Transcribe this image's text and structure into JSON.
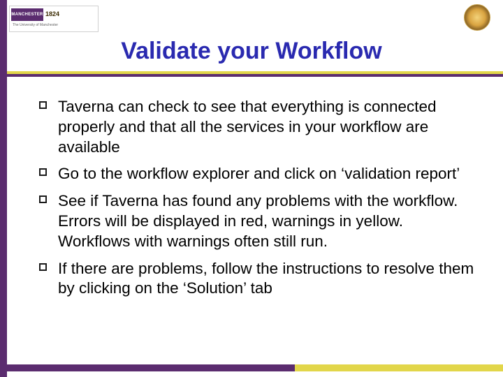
{
  "logo": {
    "badge": "MANCHESTER",
    "year": "1824",
    "sub": "The University of Manchester"
  },
  "title": "Validate your Workflow",
  "bullets": [
    "Taverna can check to see that everything is connected properly and that all the services in your workflow are available",
    "Go to the workflow explorer and click on ‘validation report’",
    "See if Taverna has found any problems with the workflow. Errors will be displayed in red, warnings in yellow. Workflows with warnings often still run.",
    "If there are problems, follow the instructions to resolve them by clicking on the ‘Solution’ tab"
  ]
}
